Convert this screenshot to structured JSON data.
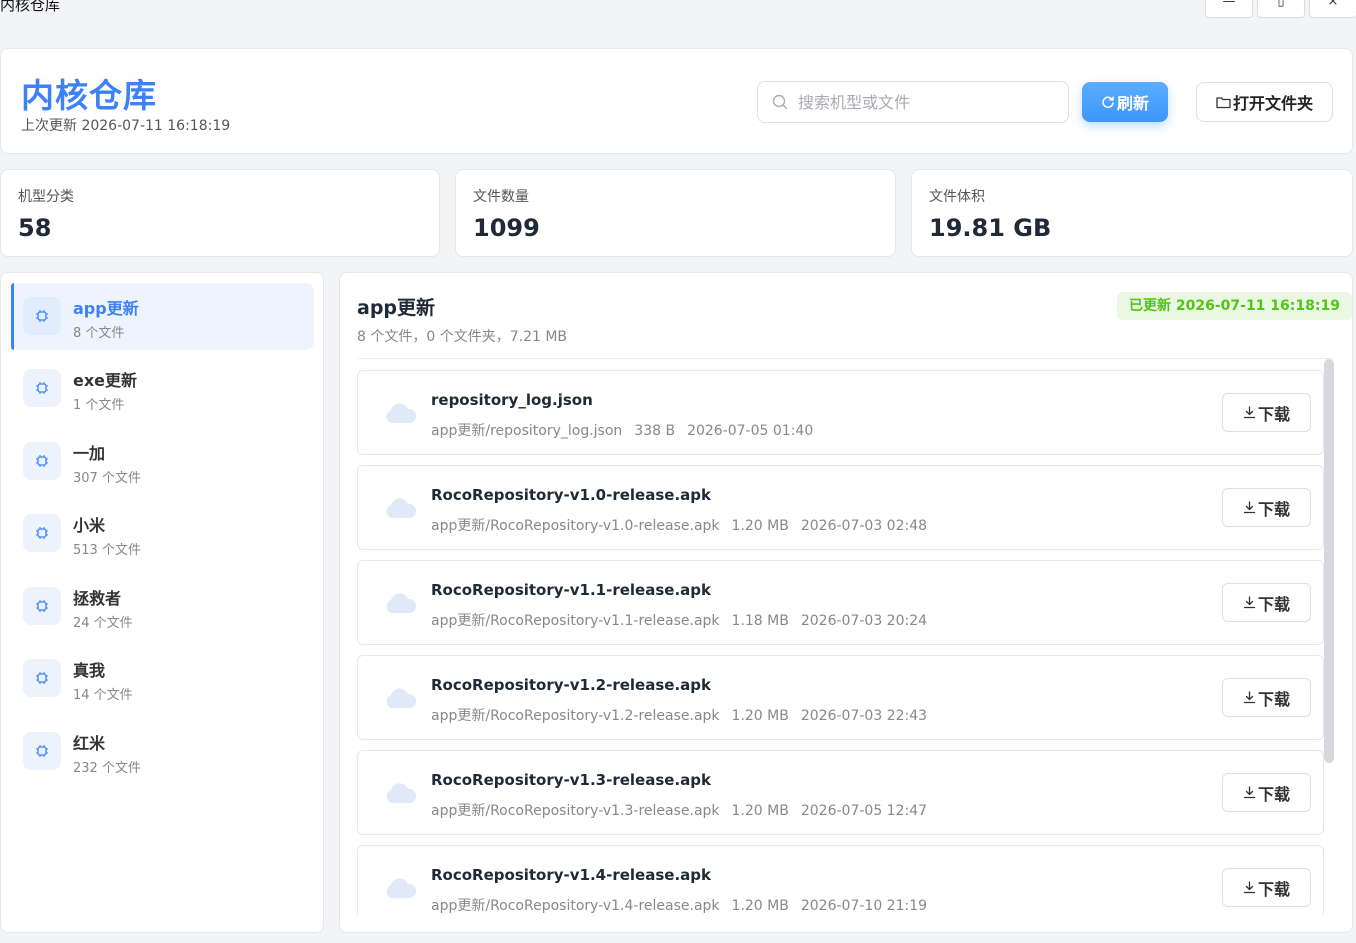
{
  "window": {
    "title": "内核仓库",
    "controls": {
      "minimize": "—",
      "maximize": "▯",
      "close": "×"
    }
  },
  "header": {
    "title": "内核仓库",
    "last_updated": "上次更新 2026-07-11 16:18:19",
    "search_placeholder": "搜索机型或文件",
    "search_value": "",
    "refresh_label": "刷新",
    "open_folder_label": "打开文件夹"
  },
  "stats": [
    {
      "label": "机型分类",
      "value": "58"
    },
    {
      "label": "文件数量",
      "value": "1099"
    },
    {
      "label": "文件体积",
      "value": "19.81 GB"
    }
  ],
  "sidebar": {
    "items": [
      {
        "name": "app更新",
        "count": "8 个文件",
        "active": true
      },
      {
        "name": "exe更新",
        "count": "1 个文件",
        "active": false
      },
      {
        "name": "一加",
        "count": "307 个文件",
        "active": false
      },
      {
        "name": "小米",
        "count": "513 个文件",
        "active": false
      },
      {
        "name": "拯救者",
        "count": "24 个文件",
        "active": false
      },
      {
        "name": "真我",
        "count": "14 个文件",
        "active": false
      },
      {
        "name": "红米",
        "count": "232 个文件",
        "active": false
      }
    ]
  },
  "content": {
    "title": "app更新",
    "summary": "8 个文件，0 个文件夹，7.21 MB",
    "updated_badge": "已更新 2026-07-11 16:18:19",
    "download_label": "下载",
    "files": [
      {
        "name": "repository_log.json",
        "path": "app更新/repository_log.json",
        "size": "338 B",
        "date": "2026-07-05 01:40"
      },
      {
        "name": "RocoRepository-v1.0-release.apk",
        "path": "app更新/RocoRepository-v1.0-release.apk",
        "size": "1.20 MB",
        "date": "2026-07-03 02:48"
      },
      {
        "name": "RocoRepository-v1.1-release.apk",
        "path": "app更新/RocoRepository-v1.1-release.apk",
        "size": "1.18 MB",
        "date": "2026-07-03 20:24"
      },
      {
        "name": "RocoRepository-v1.2-release.apk",
        "path": "app更新/RocoRepository-v1.2-release.apk",
        "size": "1.20 MB",
        "date": "2026-07-03 22:43"
      },
      {
        "name": "RocoRepository-v1.3-release.apk",
        "path": "app更新/RocoRepository-v1.3-release.apk",
        "size": "1.20 MB",
        "date": "2026-07-05 12:47"
      },
      {
        "name": "RocoRepository-v1.4-release.apk",
        "path": "app更新/RocoRepository-v1.4-release.apk",
        "size": "1.20 MB",
        "date": "2026-07-10 21:19"
      }
    ]
  },
  "colors": {
    "accent": "#3b82f6",
    "success": "#52c41a",
    "success_bg": "#eaf8e3"
  }
}
